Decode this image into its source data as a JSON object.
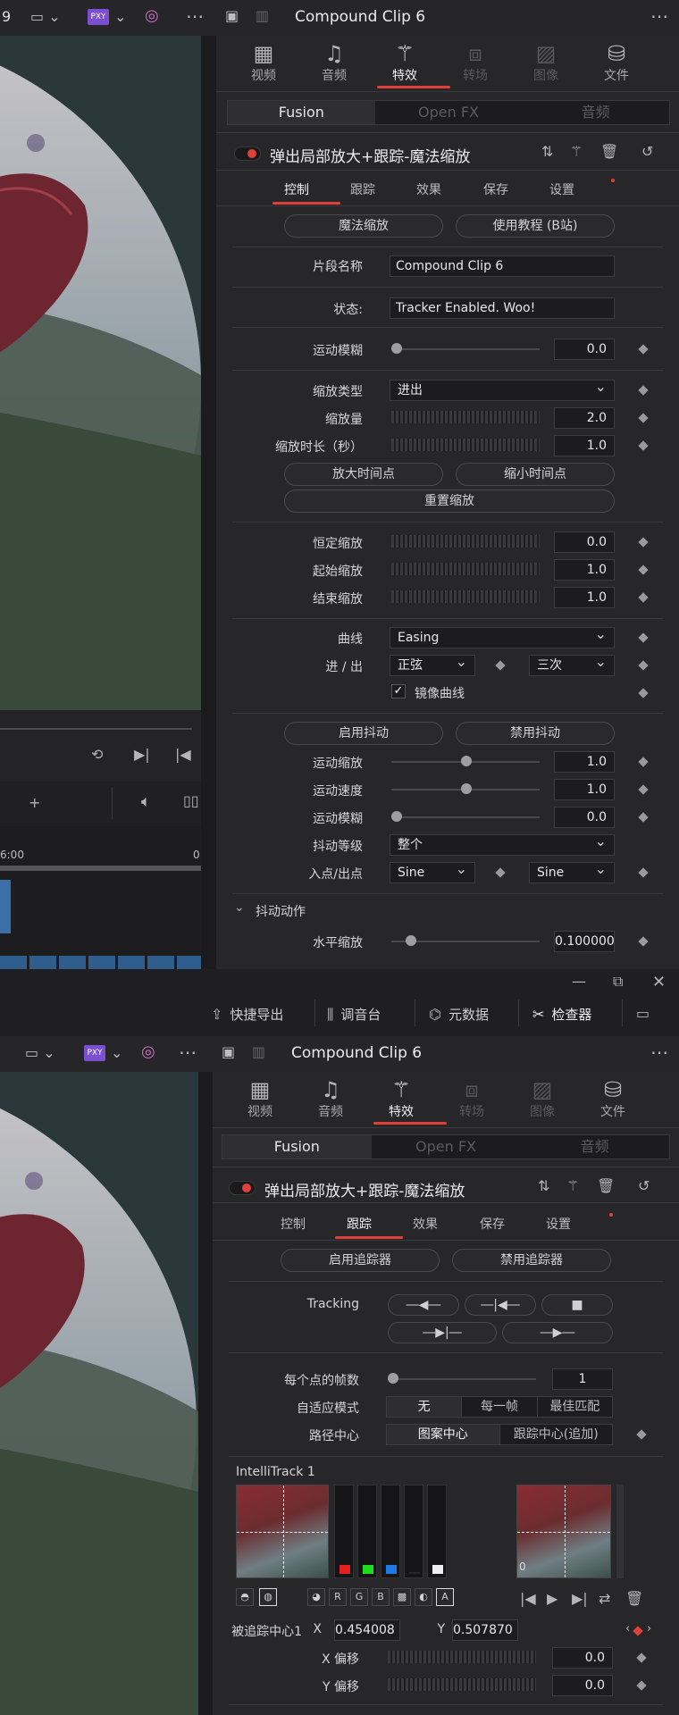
{
  "top_panel": {
    "frame_num": "9",
    "proxy_badge": "PXY",
    "clip_name": "Compound Clip 6",
    "tabs": [
      {
        "label": "视频",
        "icon": "film-icon",
        "state": "normal"
      },
      {
        "label": "音频",
        "icon": "music-note-icon",
        "state": "normal"
      },
      {
        "label": "特效",
        "icon": "magic-wand-icon",
        "state": "active"
      },
      {
        "label": "转场",
        "icon": "transition-icon",
        "state": "dim"
      },
      {
        "label": "图像",
        "icon": "image-icon",
        "state": "dim"
      },
      {
        "label": "文件",
        "icon": "file-icon",
        "state": "normal"
      }
    ],
    "segments": [
      "Fusion",
      "Open FX",
      "音频"
    ],
    "effect_title": "弹出局部放大+跟踪-魔法缩放",
    "sub_tabs": [
      "控制",
      "跟踪",
      "效果",
      "保存",
      "设置"
    ],
    "btn_magic_zoom": "魔法缩放",
    "btn_tutorial": "使用教程 (B站)",
    "clip_name_label": "片段名称",
    "clip_name_value": "Compound Clip 6",
    "status_label": "状态:",
    "status_value": "Tracker Enabled. Woo!",
    "motion_blur_label": "运动模糊",
    "motion_blur_value": "0.0",
    "zoom_type_label": "缩放类型",
    "zoom_type_value": "进出",
    "zoom_amount_label": "缩放量",
    "zoom_amount_value": "2.0",
    "zoom_duration_label": "缩放时长（秒）",
    "zoom_duration_value": "1.0",
    "btn_zoom_in_point": "放大时间点",
    "btn_zoom_out_point": "缩小时间点",
    "btn_reset_zoom": "重置缩放",
    "constant_zoom_label": "恒定缩放",
    "constant_zoom_value": "0.0",
    "start_zoom_label": "起始缩放",
    "start_zoom_value": "1.0",
    "end_zoom_label": "结束缩放",
    "end_zoom_value": "1.0",
    "curve_label": "曲线",
    "curve_value": "Easing",
    "inout_label": "进 / 出",
    "inout_a": "正弦",
    "inout_b": "三次",
    "mirror_curve_label": "镜像曲线",
    "btn_enable_shake": "启用抖动",
    "btn_disable_shake": "禁用抖动",
    "motion_zoom_label": "运动缩放",
    "motion_zoom_value": "1.0",
    "motion_speed_label": "运动速度",
    "motion_speed_value": "1.0",
    "motion_blur2_label": "运动模糊",
    "motion_blur2_value": "0.0",
    "shake_level_label": "抖动等级",
    "shake_level_value": "整个",
    "inout_points_label": "入点/出点",
    "inout_points_a": "Sine",
    "inout_points_b": "Sine",
    "shake_action_label": "抖动动作",
    "h_zoom_label": "水平缩放",
    "h_zoom_value": "0.100000",
    "timecode": "6:00",
    "timecode_end": "0"
  },
  "window_toolbar": {
    "items": [
      {
        "label": "快捷导出",
        "icon": "export-icon"
      },
      {
        "label": "调音台",
        "icon": "mixer-icon"
      },
      {
        "label": "元数据",
        "icon": "metadata-icon"
      },
      {
        "label": "检查器",
        "icon": "inspector-icon"
      }
    ]
  },
  "bottom_panel": {
    "clip_name": "Compound Clip 6",
    "proxy_badge": "PXY",
    "tabs": [
      {
        "label": "视频",
        "state": "normal"
      },
      {
        "label": "音频",
        "state": "normal"
      },
      {
        "label": "特效",
        "state": "active"
      },
      {
        "label": "转场",
        "state": "dim"
      },
      {
        "label": "图像",
        "state": "dim"
      },
      {
        "label": "文件",
        "state": "normal"
      }
    ],
    "segments": [
      "Fusion",
      "Open FX",
      "音频"
    ],
    "effect_title": "弹出局部放大+跟踪-魔法缩放",
    "sub_tabs": [
      "控制",
      "跟踪",
      "效果",
      "保存",
      "设置"
    ],
    "btn_enable_tracker": "启用追踪器",
    "btn_disable_tracker": "禁用追踪器",
    "tracking_label": "Tracking",
    "fpp_label": "每个点的帧数",
    "fpp_value": "1",
    "adaptive_label": "自适应模式",
    "adaptive_options": [
      "无",
      "每一帧",
      "最佳匹配"
    ],
    "path_center_label": "路径中心",
    "path_center_options": [
      "图案中心",
      "跟踪中心(追加)"
    ],
    "intellitrack_label": "IntelliTrack 1",
    "channels": [
      "R",
      "G",
      "B"
    ],
    "preview_zero": "0",
    "track_center_label": "被追踪中心1",
    "x_label": "X",
    "x_value": "0.454008",
    "y_label": "Y",
    "y_value": "0.507870",
    "x_offset_label": "X 偏移",
    "x_offset_value": "0.0",
    "y_offset_label": "Y 偏移",
    "y_offset_value": "0.0",
    "checker_letter": "A"
  }
}
